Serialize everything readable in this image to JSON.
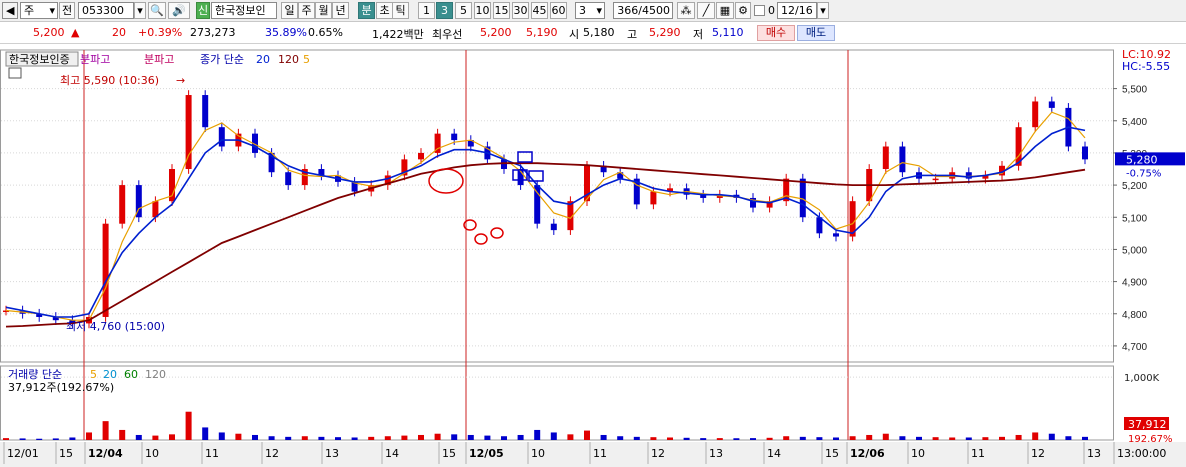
{
  "toolbar": {
    "market": "주",
    "prev_label": "전",
    "code": "053300",
    "badge": "신",
    "stock_name": "한국정보인",
    "periods": [
      "일",
      "주",
      "월",
      "년",
      "분",
      "초",
      "틱"
    ],
    "selected_period": "분",
    "intervals": [
      "1",
      "3",
      "5",
      "10",
      "15",
      "30",
      "45",
      "60"
    ],
    "selected_interval": "3",
    "custom_interval": "3",
    "count": "366/4500",
    "checkbox_label": "0",
    "date": "12/16"
  },
  "quote": {
    "price": "5,200",
    "change": "20",
    "change_pct": "+0.39%",
    "volume": "273,273",
    "turnover_pct": "35.89%",
    "ratio_pct": "0.65%",
    "amount": "1,422백만",
    "priority_label": "최우선",
    "ask": "5,200",
    "bid": "5,190",
    "open_label": "시",
    "open": "5,180",
    "high_label": "고",
    "high": "5,290",
    "low_label": "저",
    "low": "5,110",
    "buy_label": "매수",
    "sell_label": "매도"
  },
  "price_panel": {
    "legend": [
      "한국정보인증",
      "분파고",
      "분파고",
      "종가 단순",
      "20",
      "120",
      "5"
    ],
    "lc": "LC:10.92",
    "hc": "HC:-5.55",
    "high_marker": "최고 5,590 (10:36)",
    "low_marker": "최저 4,760 (15:00)",
    "current_price": "5,280",
    "current_pct": "-0.75%",
    "y_labels": [
      "5,500",
      "5,400",
      "5,300",
      "5,200",
      "5,100",
      "5,000",
      "4,900",
      "4,800",
      "4,700"
    ]
  },
  "volume_panel": {
    "legend": [
      "거래량",
      "단순",
      "5",
      "20",
      "60",
      "120"
    ],
    "info": "37,912주(192.67%)",
    "y_label": "1,000K",
    "current_volume": "37,912",
    "current_pct": "192.67%"
  },
  "x_labels": [
    "12/01",
    "15",
    "12/04",
    "10",
    "11",
    "12",
    "13",
    "14",
    "15",
    "12/05",
    "10",
    "11",
    "12",
    "13",
    "14",
    "15",
    "12/06",
    "10",
    "11",
    "12",
    "13",
    "13:00:00"
  ],
  "colors": {
    "up": "#e00000",
    "down": "#0000cc",
    "ma5": "#e8a000",
    "ma20": "#0020d0",
    "ma120": "#800000",
    "divider": "#cc2222",
    "panel_bg": "#f0f0f0"
  },
  "chart_data": {
    "type": "candlestick",
    "price_axis_ticks": [
      5500,
      5400,
      5300,
      5200,
      5100,
      5000,
      4900,
      4800,
      4700
    ],
    "series_close": [
      4810,
      4800,
      4790,
      4780,
      4770,
      4790,
      5080,
      5200,
      5100,
      5150,
      5250,
      5480,
      5380,
      5320,
      5360,
      5300,
      5240,
      5200,
      5250,
      5230,
      5210,
      5180,
      5200,
      5230,
      5280,
      5300,
      5360,
      5340,
      5320,
      5280,
      5250,
      5200,
      5080,
      5060,
      5150,
      5260,
      5240,
      5220,
      5140,
      5180,
      5190,
      5170,
      5160,
      5170,
      5160,
      5130,
      5150,
      5220,
      5100,
      5050,
      5040,
      5150,
      5250,
      5320,
      5240,
      5220,
      5220,
      5240,
      5220,
      5230,
      5260,
      5380,
      5460,
      5440,
      5320,
      5280
    ],
    "ma20": [
      4820,
      4810,
      4800,
      4790,
      4790,
      4800,
      4900,
      4990,
      5050,
      5100,
      5140,
      5220,
      5300,
      5340,
      5340,
      5320,
      5290,
      5260,
      5240,
      5230,
      5220,
      5210,
      5210,
      5220,
      5240,
      5260,
      5290,
      5310,
      5310,
      5300,
      5280,
      5260,
      5200,
      5150,
      5140,
      5170,
      5200,
      5220,
      5210,
      5190,
      5180,
      5175,
      5170,
      5170,
      5165,
      5150,
      5145,
      5160,
      5140,
      5100,
      5060,
      5050,
      5100,
      5180,
      5220,
      5230,
      5230,
      5230,
      5225,
      5230,
      5240,
      5270,
      5320,
      5360,
      5380,
      5370
    ],
    "ma120": [
      4760,
      4762,
      4765,
      4768,
      4770,
      4780,
      4810,
      4840,
      4870,
      4900,
      4930,
      4960,
      4990,
      5020,
      5040,
      5060,
      5080,
      5100,
      5120,
      5140,
      5160,
      5175,
      5190,
      5205,
      5220,
      5235,
      5245,
      5255,
      5262,
      5266,
      5268,
      5268,
      5268,
      5266,
      5264,
      5262,
      5258,
      5254,
      5250,
      5246,
      5242,
      5238,
      5234,
      5230,
      5226,
      5222,
      5218,
      5214,
      5210,
      5206,
      5202,
      5200,
      5200,
      5200,
      5202,
      5204,
      5206,
      5208,
      5210,
      5212,
      5214,
      5218,
      5224,
      5232,
      5240,
      5248
    ],
    "volume": [
      30,
      25,
      20,
      25,
      40,
      120,
      300,
      160,
      80,
      70,
      90,
      450,
      200,
      120,
      100,
      80,
      60,
      50,
      60,
      50,
      45,
      40,
      50,
      60,
      70,
      80,
      100,
      90,
      80,
      70,
      60,
      80,
      160,
      120,
      90,
      150,
      80,
      60,
      50,
      45,
      40,
      35,
      30,
      30,
      28,
      30,
      35,
      60,
      50,
      45,
      40,
      60,
      80,
      100,
      60,
      50,
      45,
      40,
      40,
      45,
      50,
      80,
      120,
      100,
      60,
      50
    ]
  }
}
